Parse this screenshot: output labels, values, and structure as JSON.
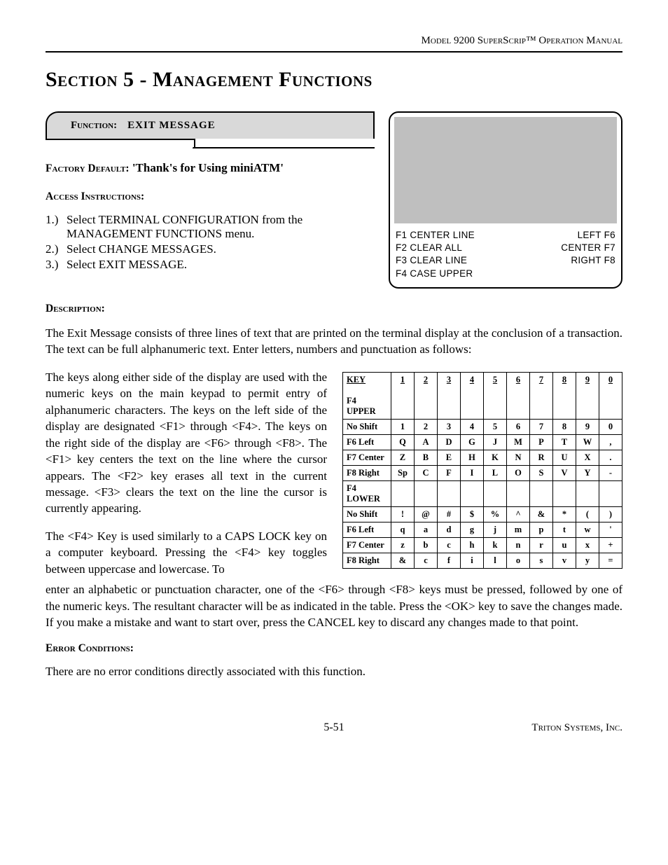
{
  "header": {
    "model": "Model 9200 SuperScrip™ Operation Manual"
  },
  "section_title": "Section 5 - Management Functions",
  "function": {
    "label": "Function:",
    "name": "EXIT MESSAGE"
  },
  "factory_default": {
    "label": "Factory Default:",
    "value": "'Thank's for Using miniATM'"
  },
  "access": {
    "label": "Access Instructions:",
    "items": [
      {
        "n": "1.)",
        "text": "Select TERMINAL CONFIGURATION from the MANAGEMENT FUNCTIONS menu."
      },
      {
        "n": "2.)",
        "text": "Select CHANGE MESSAGES."
      },
      {
        "n": "3.)",
        "text": "Select EXIT MESSAGE."
      }
    ]
  },
  "screen": {
    "left": [
      "F1 CENTER LINE",
      "F2 CLEAR ALL",
      "F3 CLEAR LINE",
      "F4 CASE UPPER"
    ],
    "right": [
      "LEFT F6",
      "CENTER F7",
      "RIGHT F8"
    ]
  },
  "description": {
    "label": "Description:",
    "p1": "The Exit Message consists of three lines of text that are printed on the terminal display at the conclusion of a transaction.  The text can be full alphanumeric text.  Enter letters, numbers and punctuation as follows:",
    "p2": "The keys along either side of the display are used with the numeric keys on the main keypad to permit entry of alphanumeric characters.  The keys on the left side of the display are designated <F1> through <F4>.  The keys on the right side of the display are <F6> through <F8>. The <F1> key centers the text on the line where the cursor appears.  The <F2> key erases all text in the current message.  <F3> clears the text on the line the cursor is currently appearing.",
    "p3a": "The <F4> Key is used similarly to a CAPS LOCK key on a computer keyboard.  Pressing the <F4> key toggles between uppercase and lowercase.  To",
    "p3b": "enter an alphabetic or punctuation character, one of the <F6> through <F8> keys must be pressed, followed by one of the numeric keys.  The resultant character will be as indicated in the table. Press the <OK> key to save the changes made.  If you make a mistake and want to start over, press the CANCEL key to discard any changes made to that point."
  },
  "chart_data": {
    "type": "table",
    "title": "Alphanumeric key mapping",
    "columns": [
      "KEY",
      "1",
      "2",
      "3",
      "4",
      "5",
      "6",
      "7",
      "8",
      "9",
      "0"
    ],
    "sections": [
      {
        "heading": "F4 UPPER",
        "rows": [
          {
            "label": "No Shift",
            "cells": [
              "1",
              "2",
              "3",
              "4",
              "5",
              "6",
              "7",
              "8",
              "9",
              "0"
            ]
          },
          {
            "label": "F6 Left",
            "cells": [
              "Q",
              "A",
              "D",
              "G",
              "J",
              "M",
              "P",
              "T",
              "W",
              ","
            ]
          },
          {
            "label": "F7 Center",
            "cells": [
              "Z",
              "B",
              "E",
              "H",
              "K",
              "N",
              "R",
              "U",
              "X",
              "."
            ]
          },
          {
            "label": "F8 Right",
            "cells": [
              "Sp",
              "C",
              "F",
              "I",
              "L",
              "O",
              "S",
              "V",
              "Y",
              "-"
            ]
          }
        ]
      },
      {
        "heading": "F4 LOWER",
        "rows": [
          {
            "label": "No Shift",
            "cells": [
              "!",
              "@",
              "#",
              "$",
              "%",
              "^",
              "&",
              "*",
              "(",
              ")"
            ]
          },
          {
            "label": "F6 Left",
            "cells": [
              "q",
              "a",
              "d",
              "g",
              "j",
              "m",
              "p",
              "t",
              "w",
              "'"
            ]
          },
          {
            "label": "F7 Center",
            "cells": [
              "z",
              "b",
              "c",
              "h",
              "k",
              "n",
              "r",
              "u",
              "x",
              "+"
            ]
          },
          {
            "label": "F8 Right",
            "cells": [
              "&",
              "c",
              "f",
              "i",
              "l",
              "o",
              "s",
              "v",
              "y",
              "="
            ]
          }
        ]
      }
    ]
  },
  "error": {
    "label": "Error Conditions:",
    "text": "There are no error conditions directly associated with this function."
  },
  "footer": {
    "company": "Triton Systems, Inc.",
    "page": "5-51"
  }
}
